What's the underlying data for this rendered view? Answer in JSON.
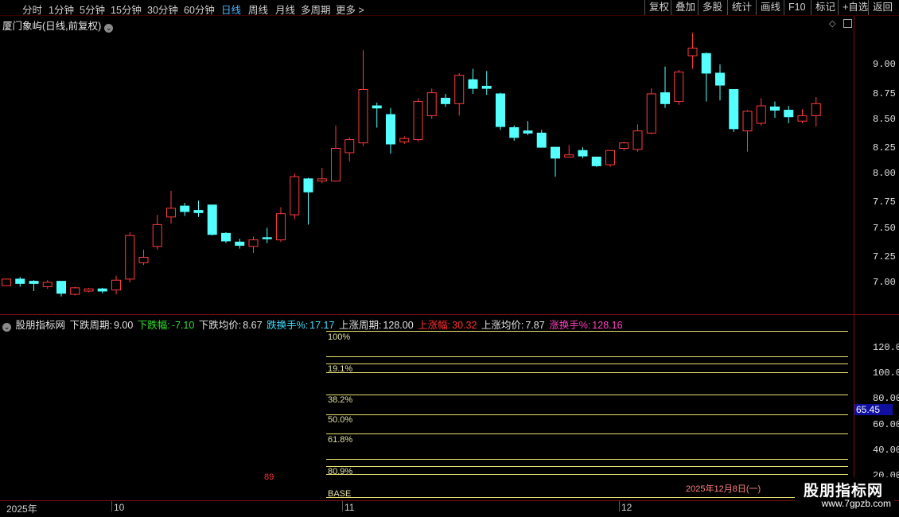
{
  "toolbar": {
    "periods": [
      "分时",
      "1分钟",
      "5分钟",
      "15分钟",
      "30分钟",
      "60分钟",
      "日线",
      "周线",
      "月线",
      "多周期",
      "更多 >"
    ],
    "active_period": "日线",
    "right_buttons": [
      "复权",
      "叠加",
      "多股",
      "统计",
      "画线",
      "F10",
      "标记",
      "+自选",
      "返回"
    ]
  },
  "main_chart": {
    "title": "厦门象屿(日线,前复权)",
    "y_ticks": [
      "9.00",
      "8.75",
      "8.50",
      "8.25",
      "8.00",
      "7.75",
      "7.50",
      "7.25",
      "7.00"
    ]
  },
  "indicator": {
    "name": "股朋指标网",
    "stats": [
      {
        "label": "下跌周期:",
        "value": "9.00",
        "color": "#e0e0e0"
      },
      {
        "label": "下跌幅:",
        "value": "-7.10",
        "color": "#30e030"
      },
      {
        "label": "下跌均价:",
        "value": "8.67",
        "color": "#e0e0e0"
      },
      {
        "label": "跌换手%:",
        "value": "17.17",
        "color": "#40e0ff"
      },
      {
        "label": "上涨周期:",
        "value": "128.00",
        "color": "#e0e0e0"
      },
      {
        "label": "上涨幅:",
        "value": "30.32",
        "color": "#ff3030"
      },
      {
        "label": "上涨均价:",
        "value": "7.87",
        "color": "#e0e0e0"
      },
      {
        "label": "涨换手%:",
        "value": "128.16",
        "color": "#ff40c0"
      }
    ],
    "y_ticks": [
      "120.0",
      "100.0",
      "80.00",
      "60.00",
      "40.00",
      "20.00"
    ],
    "current_value": "65.45",
    "fib_labels": [
      "100%",
      "19.1%",
      "38.2%",
      "50.0%",
      "61.8%",
      "80.9%",
      "BASE"
    ],
    "marker_89": "89",
    "date_note": "2025年12月8日(一)"
  },
  "x_axis": {
    "labels": [
      "2025年",
      "10",
      "11",
      "12"
    ]
  },
  "watermark": {
    "title": "股朋指标网",
    "url": "www.7gpzb.com"
  },
  "colors": {
    "up": "#ff3c3c",
    "down": "#54ffff",
    "fib_line": "#e8e070",
    "grid": "#7a1010"
  },
  "chart_data": {
    "type": "candlestick",
    "ylim": [
      6.85,
      9.35
    ],
    "candles": [
      {
        "o": 6.97,
        "c": 7.03,
        "h": 7.03,
        "l": 6.97
      },
      {
        "o": 7.03,
        "c": 6.99,
        "h": 7.05,
        "l": 6.96
      },
      {
        "o": 7.01,
        "c": 6.99,
        "h": 7.02,
        "l": 6.92
      },
      {
        "o": 6.96,
        "c": 7.0,
        "h": 7.02,
        "l": 6.94
      },
      {
        "o": 7.01,
        "c": 6.9,
        "h": 7.01,
        "l": 6.87
      },
      {
        "o": 6.89,
        "c": 6.95,
        "h": 6.96,
        "l": 6.88
      },
      {
        "o": 6.92,
        "c": 6.94,
        "h": 6.95,
        "l": 6.91
      },
      {
        "o": 6.94,
        "c": 6.92,
        "h": 6.95,
        "l": 6.9
      },
      {
        "o": 6.93,
        "c": 7.02,
        "h": 7.06,
        "l": 6.89
      },
      {
        "o": 7.03,
        "c": 7.43,
        "h": 7.46,
        "l": 7.0
      },
      {
        "o": 7.18,
        "c": 7.23,
        "h": 7.3,
        "l": 7.16
      },
      {
        "o": 7.33,
        "c": 7.53,
        "h": 7.62,
        "l": 7.3
      },
      {
        "o": 7.6,
        "c": 7.68,
        "h": 7.84,
        "l": 7.54
      },
      {
        "o": 7.7,
        "c": 7.65,
        "h": 7.73,
        "l": 7.61
      },
      {
        "o": 7.66,
        "c": 7.64,
        "h": 7.75,
        "l": 7.6
      },
      {
        "o": 7.71,
        "c": 7.44,
        "h": 7.71,
        "l": 7.43
      },
      {
        "o": 7.45,
        "c": 7.38,
        "h": 7.46,
        "l": 7.36
      },
      {
        "o": 7.37,
        "c": 7.34,
        "h": 7.4,
        "l": 7.31
      },
      {
        "o": 7.33,
        "c": 7.39,
        "h": 7.42,
        "l": 7.27
      },
      {
        "o": 7.41,
        "c": 7.4,
        "h": 7.5,
        "l": 7.36
      },
      {
        "o": 7.39,
        "c": 7.63,
        "h": 7.69,
        "l": 7.37
      },
      {
        "o": 7.62,
        "c": 7.97,
        "h": 8.0,
        "l": 7.58
      },
      {
        "o": 7.95,
        "c": 7.83,
        "h": 7.96,
        "l": 7.53
      },
      {
        "o": 7.93,
        "c": 7.95,
        "h": 8.05,
        "l": 7.91
      },
      {
        "o": 7.93,
        "c": 8.23,
        "h": 8.44,
        "l": 7.93
      },
      {
        "o": 8.19,
        "c": 8.31,
        "h": 8.33,
        "l": 8.11
      },
      {
        "o": 8.28,
        "c": 8.77,
        "h": 9.13,
        "l": 8.25
      },
      {
        "o": 8.62,
        "c": 8.6,
        "h": 8.65,
        "l": 8.42
      },
      {
        "o": 8.54,
        "c": 8.27,
        "h": 8.6,
        "l": 8.18
      },
      {
        "o": 8.29,
        "c": 8.32,
        "h": 8.34,
        "l": 8.27
      },
      {
        "o": 8.31,
        "c": 8.66,
        "h": 8.69,
        "l": 8.29
      },
      {
        "o": 8.53,
        "c": 8.74,
        "h": 8.78,
        "l": 8.5
      },
      {
        "o": 8.69,
        "c": 8.64,
        "h": 8.73,
        "l": 8.61
      },
      {
        "o": 8.64,
        "c": 8.9,
        "h": 8.92,
        "l": 8.53
      },
      {
        "o": 8.86,
        "c": 8.78,
        "h": 8.96,
        "l": 8.73
      },
      {
        "o": 8.8,
        "c": 8.78,
        "h": 8.94,
        "l": 8.72
      },
      {
        "o": 8.73,
        "c": 8.43,
        "h": 8.74,
        "l": 8.4
      },
      {
        "o": 8.42,
        "c": 8.33,
        "h": 8.44,
        "l": 8.3
      },
      {
        "o": 8.39,
        "c": 8.37,
        "h": 8.48,
        "l": 8.35
      },
      {
        "o": 8.37,
        "c": 8.24,
        "h": 8.4,
        "l": 8.24
      },
      {
        "o": 8.24,
        "c": 8.14,
        "h": 8.24,
        "l": 7.97
      },
      {
        "o": 8.15,
        "c": 8.17,
        "h": 8.26,
        "l": 8.15
      },
      {
        "o": 8.21,
        "c": 8.16,
        "h": 8.24,
        "l": 8.14
      },
      {
        "o": 8.15,
        "c": 8.07,
        "h": 8.15,
        "l": 8.06
      },
      {
        "o": 8.08,
        "c": 8.21,
        "h": 8.21,
        "l": 8.06
      },
      {
        "o": 8.23,
        "c": 8.28,
        "h": 8.29,
        "l": 8.21
      },
      {
        "o": 8.22,
        "c": 8.39,
        "h": 8.45,
        "l": 8.2
      },
      {
        "o": 8.37,
        "c": 8.73,
        "h": 8.78,
        "l": 8.36
      },
      {
        "o": 8.74,
        "c": 8.64,
        "h": 8.98,
        "l": 8.6
      },
      {
        "o": 8.66,
        "c": 8.93,
        "h": 8.95,
        "l": 8.63
      },
      {
        "o": 9.08,
        "c": 9.15,
        "h": 9.29,
        "l": 8.96
      },
      {
        "o": 9.1,
        "c": 8.92,
        "h": 9.11,
        "l": 8.66
      },
      {
        "o": 8.92,
        "c": 8.81,
        "h": 9.0,
        "l": 8.67
      },
      {
        "o": 8.77,
        "c": 8.41,
        "h": 8.77,
        "l": 8.38
      },
      {
        "o": 8.39,
        "c": 8.57,
        "h": 8.58,
        "l": 8.2
      },
      {
        "o": 8.46,
        "c": 8.62,
        "h": 8.69,
        "l": 8.44
      },
      {
        "o": 8.61,
        "c": 8.58,
        "h": 8.66,
        "l": 8.51
      },
      {
        "o": 8.58,
        "c": 8.52,
        "h": 8.62,
        "l": 8.46
      },
      {
        "o": 8.48,
        "c": 8.53,
        "h": 8.59,
        "l": 8.46
      },
      {
        "o": 8.53,
        "c": 8.64,
        "h": 8.7,
        "l": 8.43
      }
    ]
  }
}
